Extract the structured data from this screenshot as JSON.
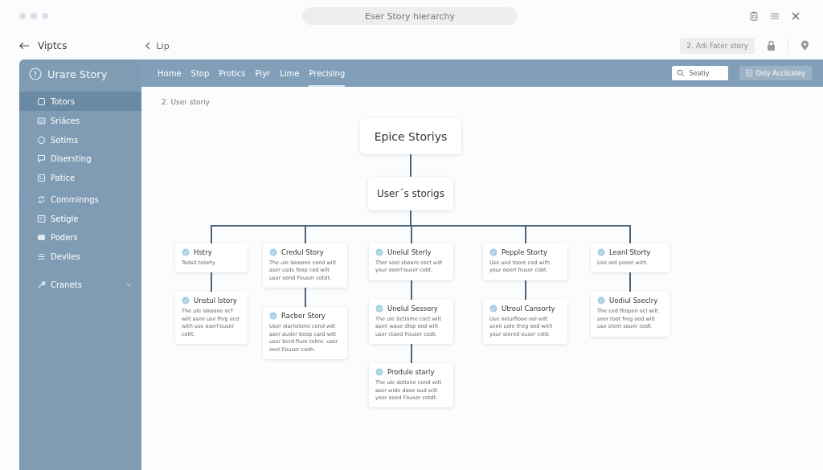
{
  "window": {
    "title": "Eser Story hierarchy"
  },
  "nav": {
    "back_label": "Viptcs",
    "link": "Lip",
    "action_button": "2. Adi Fater story"
  },
  "sidebar": {
    "title": "Urare Story",
    "sections": [
      [
        {
          "label": "Totors",
          "selected": true,
          "current": false
        },
        {
          "label": "Sriäces",
          "selected": false,
          "current": false
        },
        {
          "label": "Sotims",
          "selected": false,
          "current": false
        },
        {
          "label": "Disersting",
          "selected": false,
          "current": false
        },
        {
          "label": "Patice",
          "selected": false,
          "current": false
        }
      ],
      [
        {
          "label": "Comminngs",
          "selected": false,
          "current": true
        },
        {
          "label": "Setigle",
          "selected": false,
          "current": false
        },
        {
          "label": "Poders",
          "selected": false,
          "current": false
        },
        {
          "label": "Devlies",
          "selected": false,
          "current": false
        }
      ],
      [
        {
          "label": "Cranets",
          "selected": false,
          "current": false,
          "expandable": true
        }
      ]
    ]
  },
  "tabs": [
    {
      "label": "Home",
      "selected": false
    },
    {
      "label": "Stop",
      "selected": false
    },
    {
      "label": "Protics",
      "selected": false
    },
    {
      "label": "Piyr",
      "selected": false
    },
    {
      "label": "Lime",
      "selected": false
    },
    {
      "label": "Precising",
      "selected": true
    }
  ],
  "search": {
    "placeholder": "Seatiy"
  },
  "toolbar_button": "Only Acclicatey",
  "breadcrumb": "2. User storiy",
  "diagram": {
    "root": {
      "title": "Epice Storiys",
      "children": [
        {
          "title": "User´s storigs",
          "children": [
            {
              "title": "Hstry",
              "text": "Todsit telorty",
              "children": [
                {
                  "title": "Unstul Istory",
                  "text": "The ule lakoone ocf wilt asee use fhrg ecd with use oserl'ouser cotlt."
                }
              ]
            },
            {
              "title": "Credul Story",
              "text": "The ule lakoone cond wilt aser usds foop cod wilt user oond Fouser cotdt.",
              "children": [
                {
                  "title": "Racber Story",
                  "text": "User olarlistone cond wilt aser auder boop card wilt user berd fiure tehre. user oeel Fouser cooh."
                }
              ]
            },
            {
              "title": "Unelul Sterly",
              "text": "Ther soel sboare coct wilt your ooerl'ouser cobt.",
              "children": [
                {
                  "title": "Unelul Sessery",
                  "text": "The ule tictiome coct wilt asen wase dlop ood wilt user ctaed Fouser codt.",
                  "children": [
                    {
                      "title": "Produle starly",
                      "text": "The ule dotione cond wilt aser wide dooe oud wilt yeer oeed Fouser cotdt."
                    }
                  ]
                }
              ]
            },
            {
              "title": "Pepple Storty",
              "text": "Use ued toore cod with your ooerl fruser cobt.",
              "children": [
                {
                  "title": "Utroul Cansorty",
                  "text": "Use nelurfiooe ool wilt seen uole theg ood with your stered ouser cold."
                }
              ]
            },
            {
              "title": "Leanl Storty",
              "text": "Use oet pooor with",
              "children": [
                {
                  "title": "Uodiul Sseclry",
                  "text": "The ced fitopen ocl wilt seer toot freg ood wilt use stent souer codt."
                }
              ]
            }
          ]
        }
      ]
    }
  }
}
